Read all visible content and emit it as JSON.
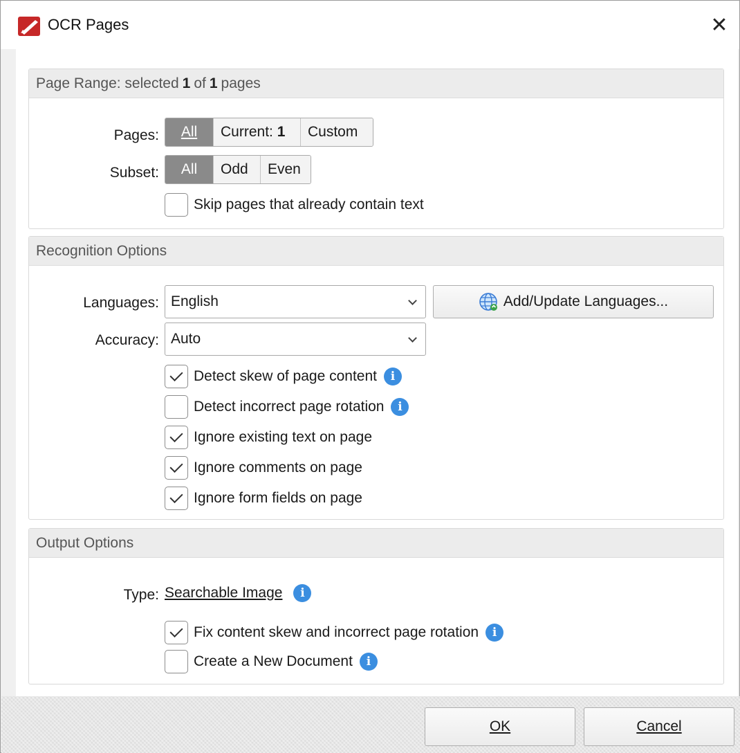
{
  "window": {
    "title": "OCR Pages",
    "close_glyph": "✕",
    "icon": "pdf-app-icon"
  },
  "page_range": {
    "header_prefix": "Page Range: selected",
    "selected": "1",
    "of_word": "of",
    "total": "1",
    "header_suffix": "pages",
    "pages_label": "Pages:",
    "pages_options": [
      "All",
      "Current:",
      "Custom"
    ],
    "current_page": "1",
    "pages_selected": "All",
    "subset_label": "Subset:",
    "subset_options": [
      "All",
      "Odd",
      "Even"
    ],
    "subset_selected": "All",
    "skip_text": {
      "label": "Skip pages that already contain text",
      "checked": false
    }
  },
  "recognition": {
    "header": "Recognition Options",
    "languages_label": "Languages:",
    "languages_value": "English",
    "add_update_label": "Add/Update Languages...",
    "accuracy_label": "Accuracy:",
    "accuracy_value": "Auto",
    "checkboxes": [
      {
        "label": "Detect skew of page content",
        "checked": true,
        "info": true
      },
      {
        "label": "Detect incorrect page rotation",
        "checked": false,
        "info": true
      },
      {
        "label": "Ignore existing text on page",
        "checked": true,
        "info": false
      },
      {
        "label": "Ignore comments on page",
        "checked": true,
        "info": false
      },
      {
        "label": "Ignore form fields on page",
        "checked": true,
        "info": false
      }
    ]
  },
  "output": {
    "header": "Output Options",
    "type_label": "Type:",
    "type_value": "Searchable Image",
    "checkboxes": [
      {
        "label": "Fix content skew and incorrect page rotation",
        "checked": true,
        "info": true
      },
      {
        "label": "Create a New Document",
        "checked": false,
        "info": true
      }
    ]
  },
  "footer": {
    "ok_label": "OK",
    "cancel_label": "Cancel"
  },
  "colors": {
    "active_segment": "#8a8a8a",
    "info_icon": "#3b8ee0",
    "group_header_bg": "#ececec"
  }
}
